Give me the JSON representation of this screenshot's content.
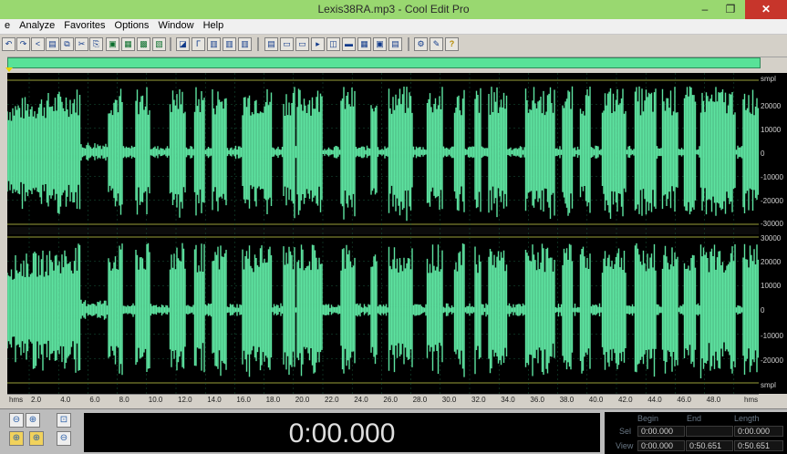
{
  "window": {
    "title": "Lexis38RA.mp3 - Cool Edit Pro",
    "minimize_glyph": "–",
    "restore_glyph": "❐",
    "close_glyph": "✕"
  },
  "menu": [
    "e",
    "Analyze",
    "Favorites",
    "Options",
    "Window",
    "Help"
  ],
  "toolbar_icons": [
    "undo-icon",
    "redo-icon",
    "loop-icon",
    "waveform-icon",
    "copy-icon",
    "cut-icon",
    "paste-icon",
    "record-icon",
    "mix-icon",
    "edit-icon",
    "multitrack-icon",
    "envelope-icon",
    "marker-icon",
    "spectral-icon",
    "cue-icon",
    "view-icon",
    "region-icon",
    "play-icon",
    "zoom-icon",
    "scroll-icon",
    "region2-icon",
    "fit-icon",
    "settings-icon",
    "properties-icon",
    "help-icon"
  ],
  "help_glyph": "?",
  "amplitude_scale": {
    "unit": "smpl",
    "channel1": [
      "20000",
      "10000",
      "0",
      "-10000",
      "-20000",
      "-30000"
    ],
    "channel2": [
      "30000",
      "20000",
      "10000",
      "0",
      "-10000",
      "-20000"
    ]
  },
  "timeline": {
    "unit": "hms",
    "ticks": [
      "2.0",
      "4.0",
      "6.0",
      "8.0",
      "10.0",
      "12.0",
      "14.0",
      "16.0",
      "18.0",
      "20.0",
      "22.0",
      "24.0",
      "26.0",
      "28.0",
      "30.0",
      "32.0",
      "34.0",
      "36.0",
      "38.0",
      "40.0",
      "42.0",
      "44.0",
      "46.0",
      "48.0"
    ]
  },
  "time_display": "0:00.000",
  "selection": {
    "headers": {
      "begin": "Begin",
      "end": "End",
      "length": "Length"
    },
    "rows": [
      {
        "label": "Sel",
        "begin": "0:00.000",
        "end": "",
        "length": "0:00.000"
      },
      {
        "label": "View",
        "begin": "0:00.000",
        "end": "0:50.651",
        "length": "0:50.651"
      }
    ]
  },
  "colors": {
    "titlebar": "#99d870",
    "waveform": "#5de3a0",
    "background": "#000000",
    "grid": "#1a5a3c"
  }
}
